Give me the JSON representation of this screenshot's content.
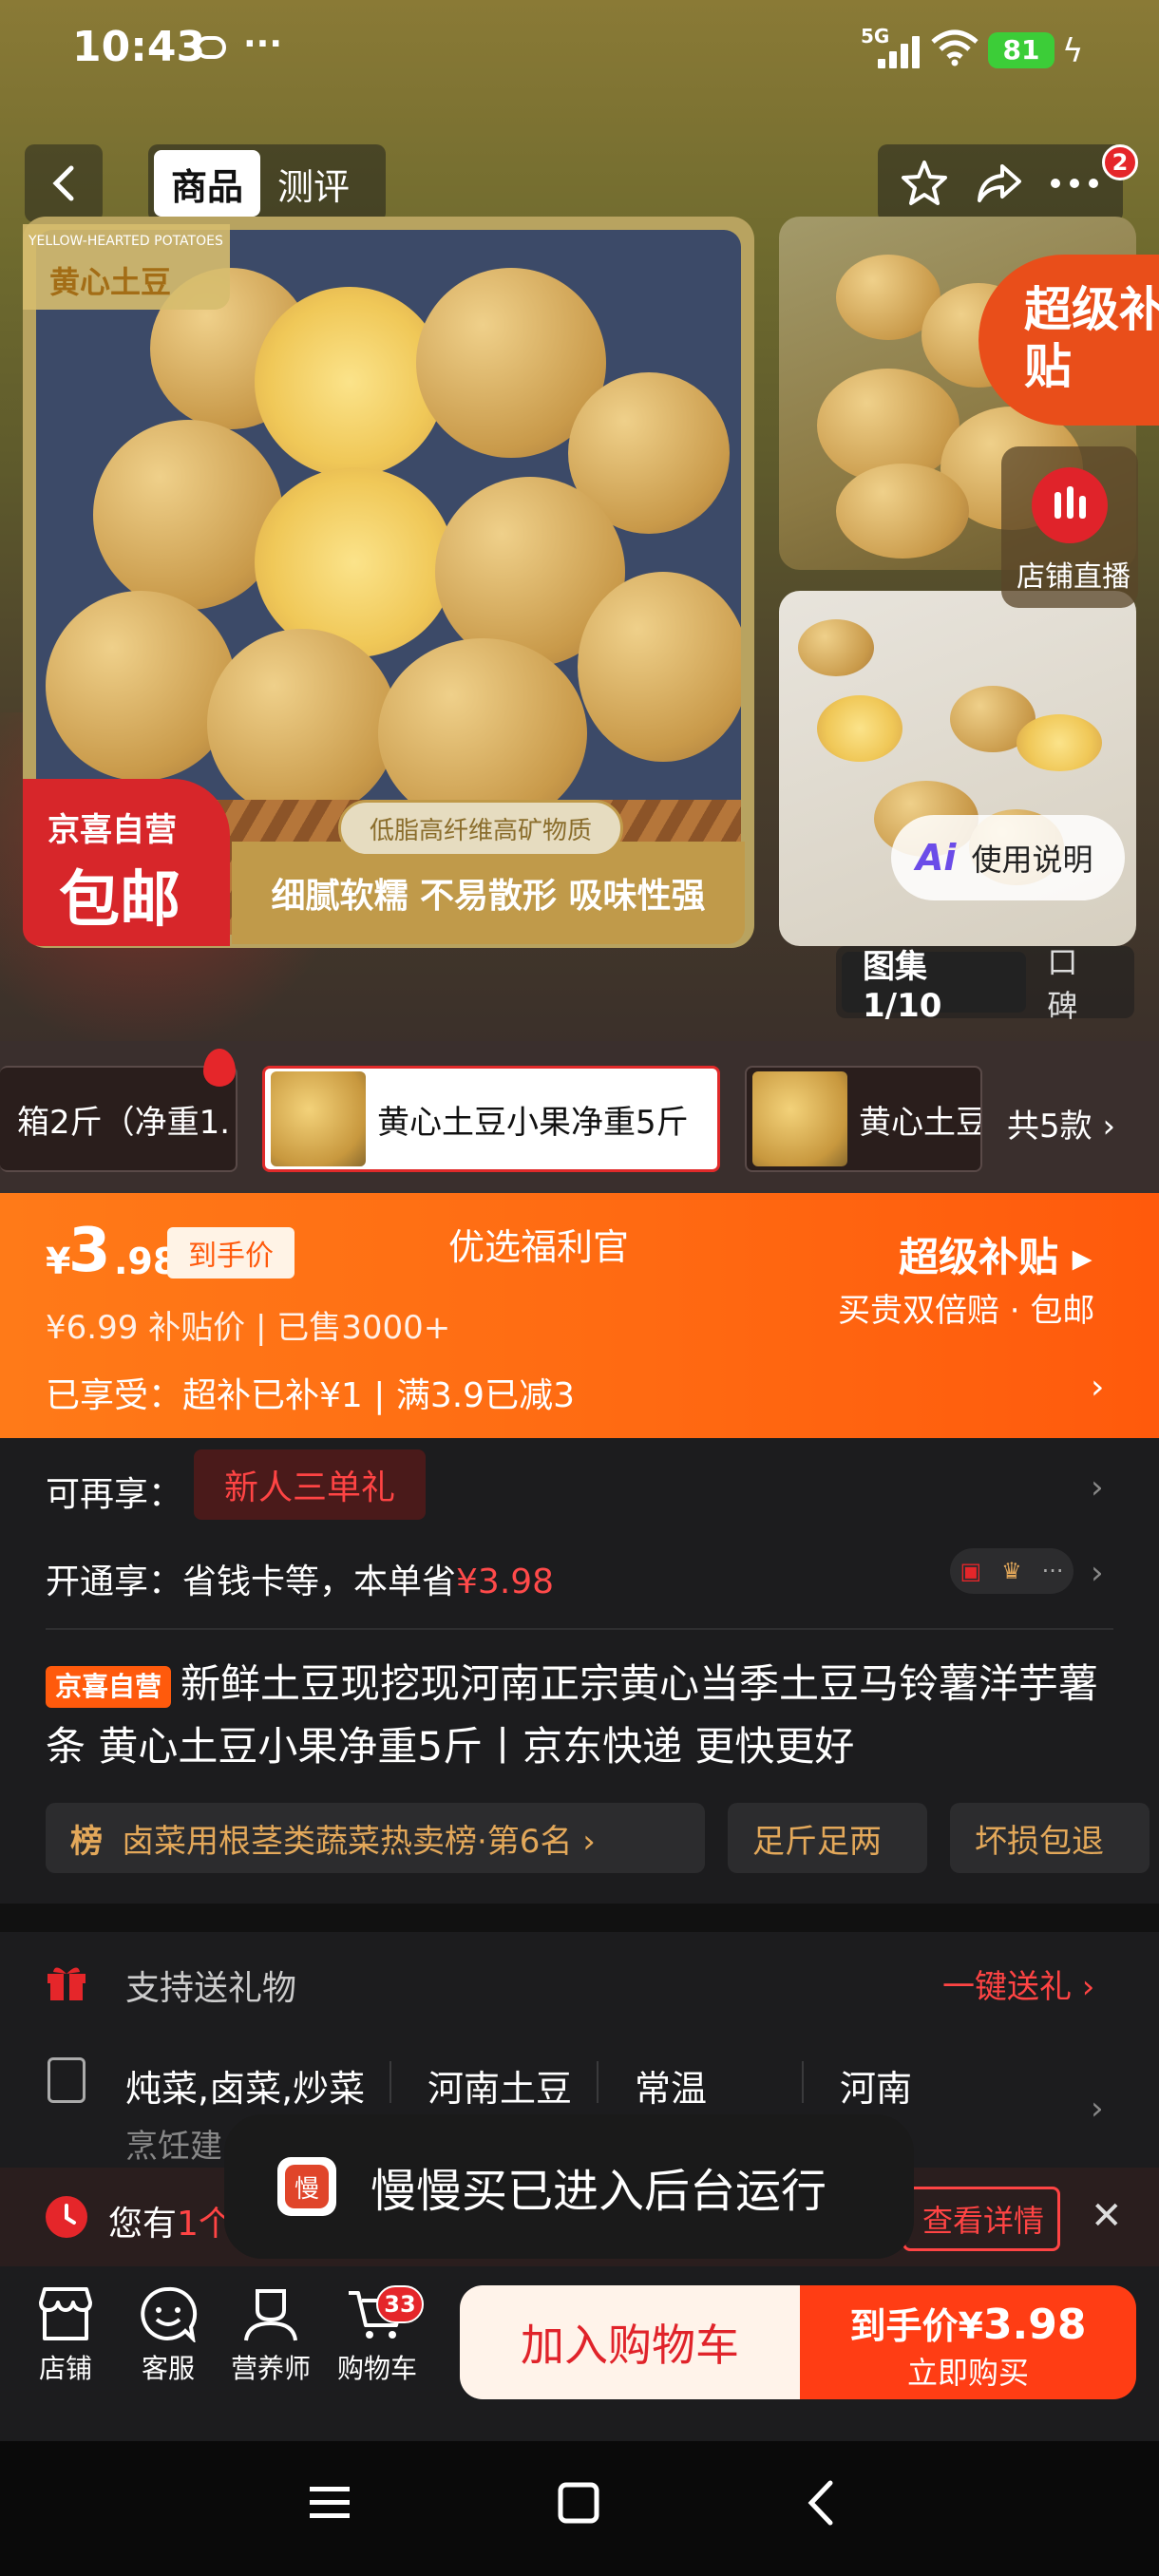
{
  "status": {
    "time": "10:43",
    "network": "5G",
    "battery": "81"
  },
  "header": {
    "tabs": [
      {
        "label": "商品"
      },
      {
        "label": "测评"
      }
    ],
    "cart_badge": "2"
  },
  "gallery": {
    "brand_en": "YELLOW-HEARTED POTATOES",
    "brand_cn": "黄心土豆",
    "self_op_line1": "京喜自营",
    "self_op_line2": "包邮",
    "feature_pill": "低脂高纤维高矿物质",
    "feature_strip": "细腻软糯 不易散形 吸味性强",
    "subsidy_badge": "超级补贴",
    "live_label": "店铺直播",
    "ai_label": "Ai",
    "ai_guide": "使用说明",
    "count": "图集1/10",
    "review_tab": "口碑"
  },
  "variants": {
    "items": [
      {
        "label": "箱2斤（净重1."
      },
      {
        "label": "黄心土豆小果净重5斤"
      },
      {
        "label": "黄心土豆"
      }
    ],
    "total": "共5款 ›"
  },
  "price": {
    "currency": "¥",
    "int": "3",
    "dec": ".98",
    "net_tag": "到手价",
    "welfare_title": "优选福利官",
    "orig_line": "¥6.99  补贴价 | 已售3000+",
    "enjoyed": "已享受：超补已补¥1 | 满3.9已减3",
    "super_title": "超级补贴",
    "super_desc": "买贵双倍赔 · 包邮"
  },
  "offers": {
    "more_label": "可再享：",
    "newbie": "新人三单礼",
    "open_label": "开通享：省钱卡等，本单省",
    "open_save": "¥3.98"
  },
  "product": {
    "chip": "京喜自营",
    "title": "新鲜土豆现挖现河南正宗黄心当季土豆马铃薯洋芋薯条 黄心土豆小果净重5斤丨京东快递 更快更好",
    "rank_badge": "榜",
    "rank": "卤菜用根茎类蔬菜热卖榜·第6名 ›",
    "weight": "足斤足两",
    "refund": "坏损包退"
  },
  "gift": {
    "label": "支持送礼物",
    "action": "一键送礼 ›"
  },
  "attributes": {
    "items": [
      "炖菜,卤菜,炒菜",
      "河南土豆",
      "常温",
      "河南"
    ],
    "sub": "烹饪建"
  },
  "coupon": {
    "text_prefix": "您有",
    "text_count": "1个",
    "button": "查看详情"
  },
  "toast": {
    "icon": "慢",
    "text": "慢慢买已进入后台运行"
  },
  "bottom": {
    "items": [
      {
        "label": "店铺"
      },
      {
        "label": "客服"
      },
      {
        "label": "营养师"
      },
      {
        "label": "购物车"
      }
    ],
    "cart_count": "33",
    "add_cart": "加入购物车",
    "buy_prefix": "到手价¥",
    "buy_price": "3.98",
    "buy_label": "立即购买"
  },
  "colors": {
    "accent": "#ff5a0c",
    "red": "#e5262a",
    "background": "#1c1c1e"
  }
}
